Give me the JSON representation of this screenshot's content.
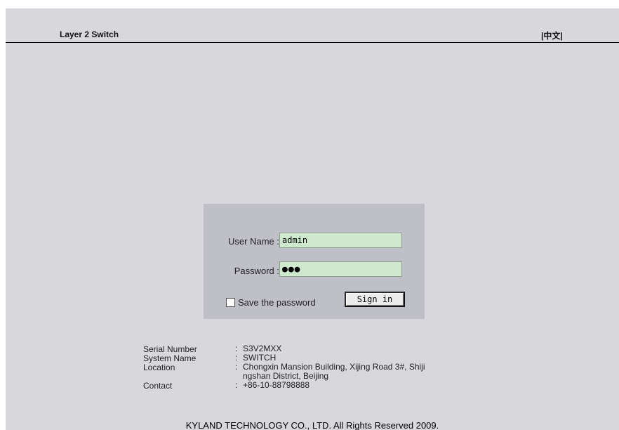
{
  "header": {
    "title": "Layer 2 Switch",
    "language_link": "|中文|"
  },
  "login": {
    "username_label": "User Name :",
    "username_value": "admin",
    "password_label": "Password :",
    "password_masked": "●●●",
    "save_password_label": "Save the password",
    "save_password_checked": false,
    "signin_label": "Sign in"
  },
  "system_info": {
    "serial_label": "Serial Number",
    "serial_value": "S3V2MXX",
    "system_name_label": "System Name",
    "system_name_value": "SWITCH",
    "location_label": "Location",
    "location_value_line1": "Chongxin Mansion Building, Xijing Road 3#, Shiji",
    "location_value_line2": "ngshan District, Beijing",
    "contact_label": "Contact",
    "contact_value": "+86-10-88798888",
    "separator": ":"
  },
  "footer": {
    "copyright": "KYLAND TECHNOLOGY CO., LTD. All Rights Reserved 2009."
  },
  "colors": {
    "page_background": "#d8d8dc",
    "panel_background": "#bfbfc7",
    "input_background": "#cfe9cf"
  }
}
